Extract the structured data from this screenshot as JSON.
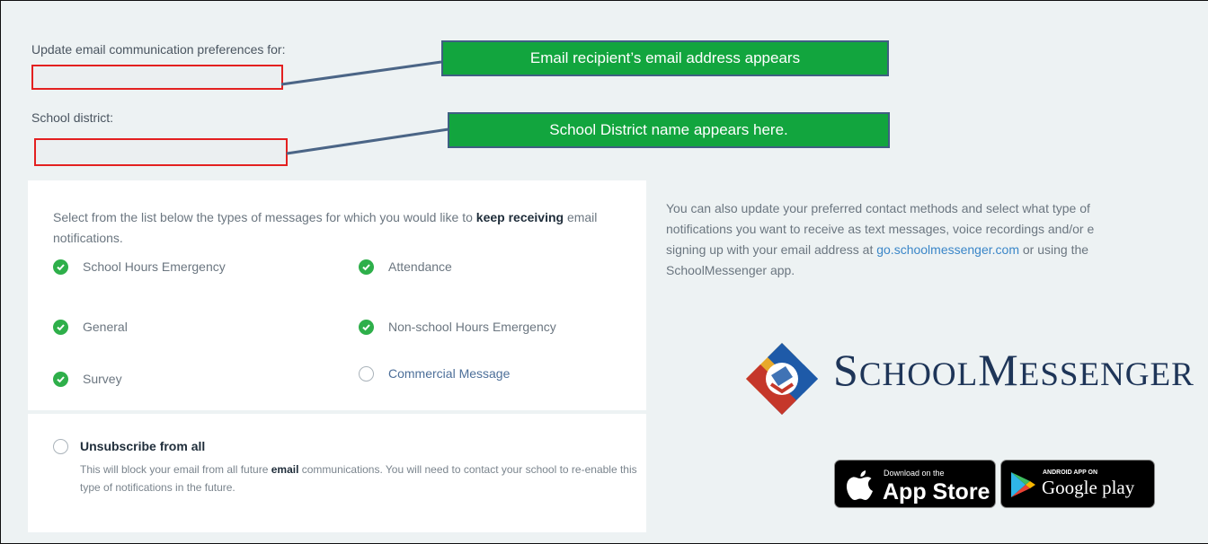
{
  "prefs": {
    "email_label": "Update email communication preferences for:",
    "email_value": "",
    "district_label": "School district:",
    "district_value": ""
  },
  "callouts": {
    "email": "Email recipient’s email address appears",
    "district": "School District name appears here."
  },
  "notifications": {
    "intro_before": "Select from the list below the types of messages for which you would like to ",
    "intro_bold": "keep receiving",
    "intro_after": " email notifications.",
    "options": [
      {
        "label": "School Hours Emergency",
        "checked": true
      },
      {
        "label": "Attendance",
        "checked": true
      },
      {
        "label": "General",
        "checked": true
      },
      {
        "label": "Non-school Hours Emergency",
        "checked": true
      },
      {
        "label": "Survey",
        "checked": true
      },
      {
        "label": "Commercial Message",
        "checked": false
      }
    ]
  },
  "unsubscribe": {
    "title": "Unsubscribe from all",
    "desc_before": "This will block your email from all future ",
    "desc_bold": "email",
    "desc_after": " communications. You will need to contact your school to re-enable this type of notifications in the future."
  },
  "info": {
    "line1": "You can also update your preferred contact methods and select what type of",
    "line2": "notifications you want to receive as text messages, voice recordings and/or e",
    "line3_before": "signing up with your email address at ",
    "link": "go.schoolmessenger.com",
    "line3_after": " or using the",
    "line4": "SchoolMessenger app."
  },
  "logo": {
    "big1": "S",
    "small1": "CHOOL",
    "big2": "M",
    "small2": "ESSENGER",
    "colors": [
      "#e8a92b",
      "#c5372a",
      "#1e5aa8",
      "#ffffff"
    ]
  },
  "badges": {
    "appstore_small": "Download on the",
    "appstore_big": "App Store",
    "googleplay_small": "ANDROID APP ON",
    "googleplay_big": "Google play"
  },
  "colors": {
    "callout_fill": "#12a53e",
    "highlight_border": "#e32020",
    "check_green": "#2eaf4a",
    "link_blue": "#3a86c8"
  }
}
